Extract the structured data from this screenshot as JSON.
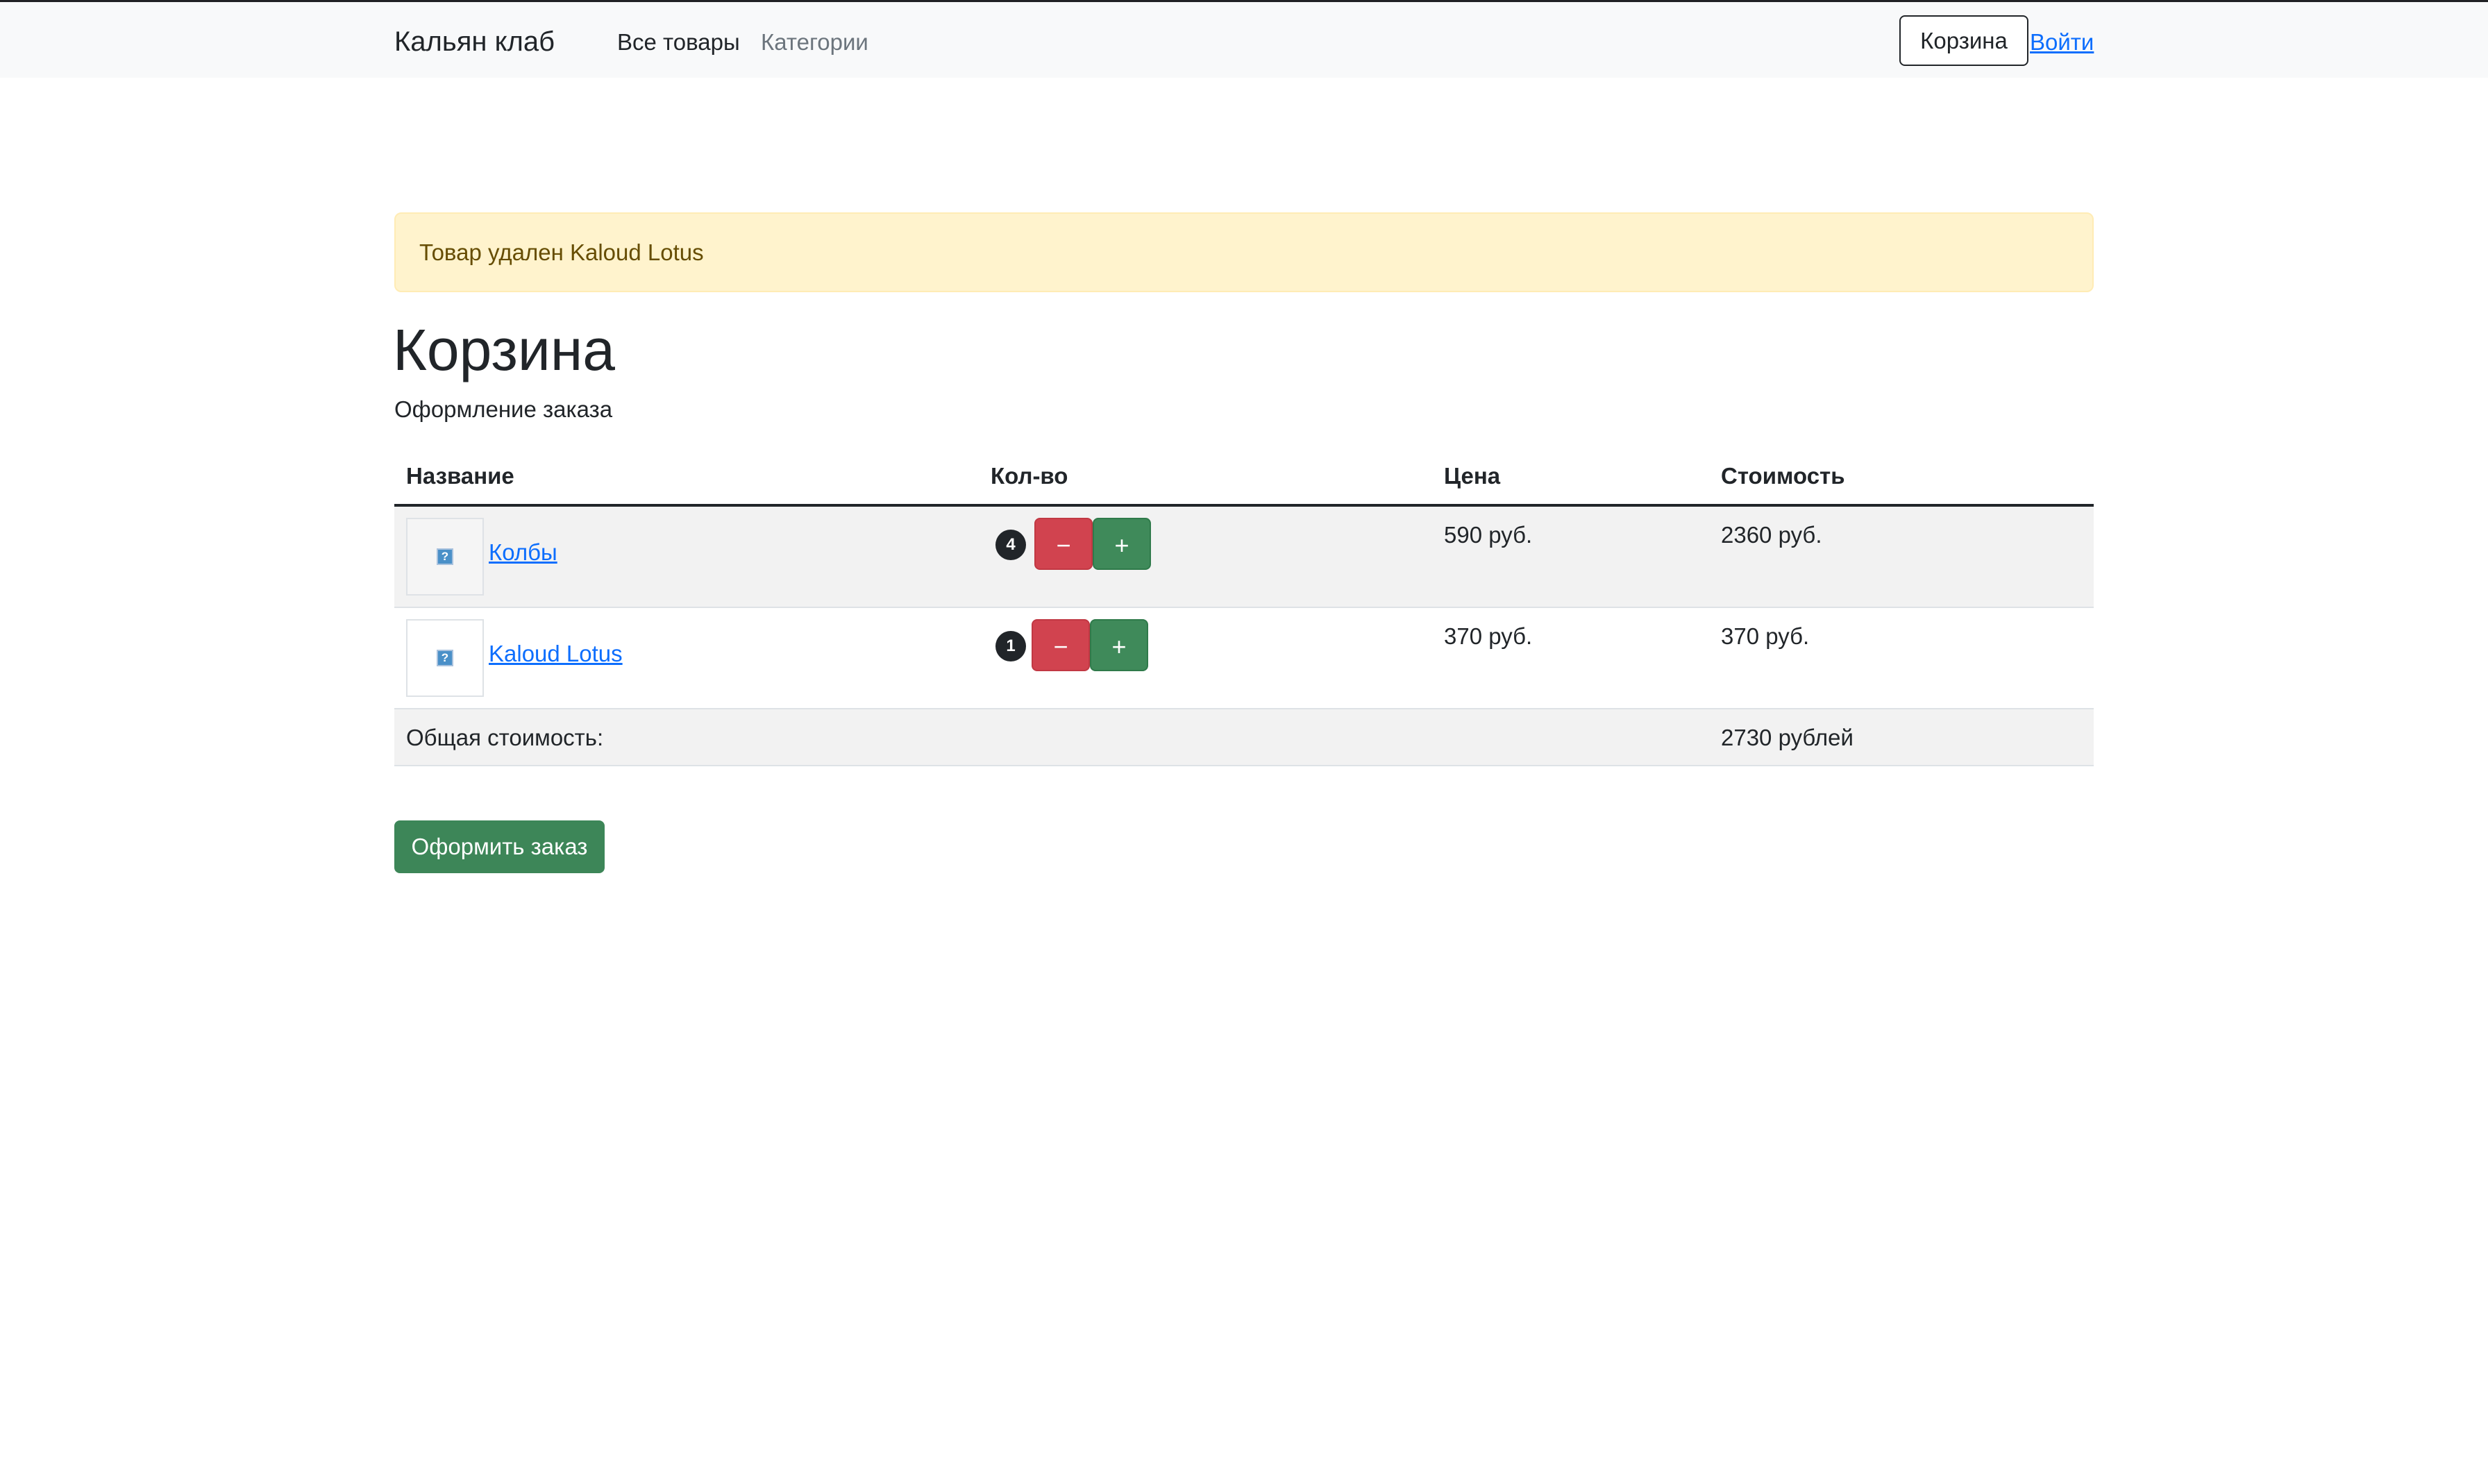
{
  "navbar": {
    "brand": "Кальян клаб",
    "links": [
      {
        "label": "Все товары"
      },
      {
        "label": "Категории"
      }
    ],
    "cart_button": "Корзина",
    "login_link": "Войти"
  },
  "alert": {
    "message": "Товар удален Kaloud Lotus"
  },
  "page": {
    "title": "Корзина",
    "subtitle": "Оформление заказа"
  },
  "table": {
    "columns": [
      "Название",
      "Кол-во",
      "Цена",
      "Стоимость"
    ],
    "rows": [
      {
        "name": "Колбы",
        "qty": "4",
        "price": "590 руб.",
        "cost": "2360 руб."
      },
      {
        "name": "Kaloud Lotus",
        "qty": "1",
        "price": "370 руб.",
        "cost": "370 руб."
      }
    ],
    "total_label": "Общая стоимость:",
    "total_value": "2730 рублей"
  },
  "controls": {
    "minus_glyph": "−",
    "plus_glyph": "+",
    "missing_image_glyph": "?"
  },
  "order_button": "Оформить заказ",
  "colors": {
    "navbar_bg": "#f8f9fa",
    "alert_bg": "#fff3cd",
    "danger": "#d1434f",
    "success": "#3d8658",
    "link": "#0d6efd"
  }
}
